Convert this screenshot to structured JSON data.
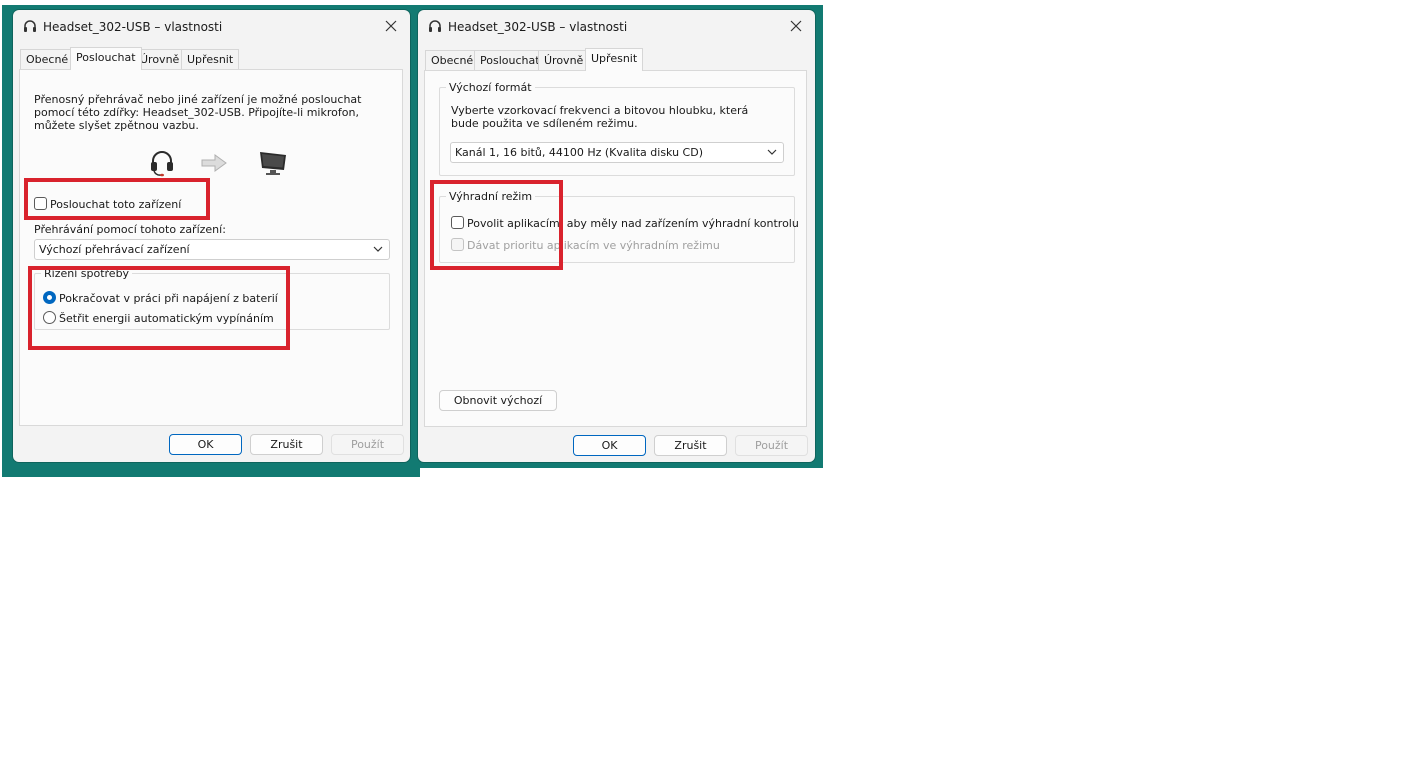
{
  "colors": {
    "backdrop": "#127a72",
    "accent": "#0067c0",
    "highlight": "#d9232d"
  },
  "left_dialog": {
    "title": "Headset_302-USB – vlastnosti",
    "tabs": [
      "Obecné",
      "Poslouchat",
      "Úrovně",
      "Upřesnit"
    ],
    "active_tab": "Poslouchat",
    "description": "Přenosný přehrávač nebo jiné zařízení je možné poslouchat pomocí této zdířky: Headset_302-USB. Připojíte-li mikrofon, můžete slyšet zpětnou vazbu.",
    "illustration_icons": [
      "headset-icon",
      "arrow-right-icon",
      "monitor-icon"
    ],
    "listen_checkbox_label": "Poslouchat toto zařízení",
    "listen_checked": false,
    "playback_label": "Přehrávání pomocí tohoto zařízení:",
    "playback_select_value": "Výchozí přehrávací zařízení",
    "power_group_label": "Řízení spotřeby",
    "power_options": [
      {
        "label": "Pokračovat v práci při napájení z baterií",
        "checked": true
      },
      {
        "label": "Šetřit energii automatickým vypínáním",
        "checked": false
      }
    ],
    "buttons": {
      "ok": "OK",
      "cancel": "Zrušit",
      "apply": "Použít"
    }
  },
  "right_dialog": {
    "title": "Headset_302-USB – vlastnosti",
    "tabs": [
      "Obecné",
      "Poslouchat",
      "Úrovně",
      "Upřesnit"
    ],
    "active_tab": "Upřesnit",
    "format_group_label": "Výchozí formát",
    "format_description": "Vyberte vzorkovací frekvenci a bitovou hloubku, která bude použita ve sdíleném režimu.",
    "format_select_value": "Kanál 1, 16 bitů, 44100 Hz (Kvalita disku CD)",
    "exclusive_group_label": "Výhradní režim",
    "exclusive_options": [
      {
        "label": "Povolit aplikacím, aby měly nad zařízením výhradní kontrolu",
        "checked": false,
        "enabled": true
      },
      {
        "label": "Dávat prioritu aplikacím ve výhradním režimu",
        "checked": false,
        "enabled": false
      }
    ],
    "restore_defaults_label": "Obnovit výchozí",
    "buttons": {
      "ok": "OK",
      "cancel": "Zrušit",
      "apply": "Použít"
    }
  }
}
